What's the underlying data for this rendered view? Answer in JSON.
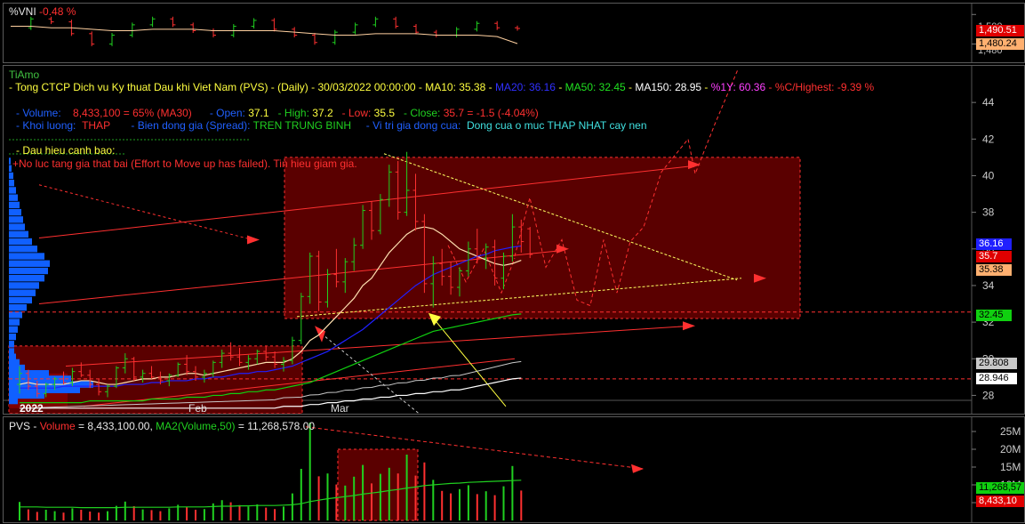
{
  "vni": {
    "title": "%VNI",
    "change": "-0.48 %",
    "tick_top": "1,500",
    "tick_bottom": "1,480",
    "tag_price": "1,490.51",
    "tag_ma": "1,480.24"
  },
  "main": {
    "brand": "TiAmo",
    "header": {
      "prefix": "- Tong CTCP Dich vu Ky thuat Dau khi Viet Nam (PVS) - (Daily) - 30/03/2022 00:00:00 - ",
      "ma10": "MA10: 35.38",
      "ma20": "MA20: 36.16",
      "ma50": "MA50: 32.45",
      "ma150": "MA150: 28.95",
      "one_year": "%1Y: 60.36",
      "c_high": "%C/Highest: -9.39 %"
    },
    "row2": {
      "volume_label": "- Volume:",
      "volume_value": "8,433,100  =  65%  (MA30)",
      "open_label": "- Open:",
      "open_value": "37.1",
      "high_label": "- High:",
      "high_value": "37.2",
      "low_label": "- Low:",
      "low_value": "35.5",
      "close_label": "- Close:",
      "close_value": "35.7  =  -1.5  (-4.04%)"
    },
    "row3": {
      "kl_label": "- Khoi luong:",
      "kl_value": "THAP",
      "spread_label": "- Bien dong gia (Spread):",
      "spread_value": "TREN TRUNG BINH",
      "pos_label": "- Vi tri gia dong cua:",
      "pos_value": "Dong cua o muc THAP NHAT cay nen"
    },
    "warning_title": "- Dau hieu canh bao:",
    "warning_text": "+No luc tang gia that bai (Effort to Move up has failed). Tin hieu giam gia.",
    "x_year": "2022",
    "x_feb": "Feb",
    "x_mar": "Mar",
    "price_tags": {
      "ma20": "36.16",
      "close": "35.7",
      "ma10": "35.38",
      "ma50": "32.45",
      "p1": "29.808",
      "ma150": "28.946"
    }
  },
  "vol": {
    "prefix": "PVS - ",
    "volume_label": "Volume",
    "volume_value": " = 8,433,100.00, ",
    "ma_label": "MA2(Volume,50)",
    "ma_value": " = 11,268,578.00",
    "tag_ma": "11,268,57",
    "tag_vol": "8,433,10"
  },
  "chart_data": [
    {
      "type": "line",
      "title": "%VNI",
      "ylim": [
        1470,
        1505
      ],
      "yticks": [
        "1,500",
        "1,480"
      ],
      "series": [
        {
          "name": "%VNI",
          "values": [
            1491,
            1497,
            1495,
            1487,
            1480,
            1486,
            1493,
            1497,
            1493,
            1489,
            1486,
            1492,
            1496,
            1490,
            1486,
            1481,
            1488,
            1493,
            1497,
            1492,
            1488,
            1486,
            1490,
            1494,
            1491,
            1490.51
          ]
        },
        {
          "name": "MA",
          "values": [
            1492,
            1492,
            1491,
            1491,
            1490,
            1489,
            1489,
            1490,
            1490,
            1490,
            1489,
            1489,
            1489,
            1489,
            1488,
            1487,
            1486,
            1486,
            1487,
            1487,
            1487,
            1486,
            1486,
            1486,
            1485,
            1480.24
          ]
        }
      ]
    },
    {
      "type": "line",
      "title": "PVS (Daily)",
      "x": [
        "2022",
        "Feb",
        "Mar"
      ],
      "ylim": [
        27,
        46
      ],
      "yticks": [
        28,
        30,
        32,
        34,
        36,
        38,
        40,
        42,
        44
      ],
      "candles": [
        {
          "o": 28.6,
          "h": 29.6,
          "l": 28.1,
          "c": 29.2
        },
        {
          "o": 29.2,
          "h": 29.4,
          "l": 28.3,
          "c": 28.5
        },
        {
          "o": 28.5,
          "h": 28.8,
          "l": 27.9,
          "c": 28.1
        },
        {
          "o": 28.1,
          "h": 28.7,
          "l": 27.9,
          "c": 28.6
        },
        {
          "o": 28.6,
          "h": 29.0,
          "l": 28.3,
          "c": 28.9
        },
        {
          "o": 28.9,
          "h": 29.3,
          "l": 28.6,
          "c": 28.7
        },
        {
          "o": 28.7,
          "h": 29.5,
          "l": 28.5,
          "c": 29.3
        },
        {
          "o": 29.3,
          "h": 29.8,
          "l": 29.0,
          "c": 29.1
        },
        {
          "o": 29.1,
          "h": 29.4,
          "l": 28.4,
          "c": 28.6
        },
        {
          "o": 28.6,
          "h": 28.9,
          "l": 28.0,
          "c": 28.2
        },
        {
          "o": 28.2,
          "h": 28.6,
          "l": 27.9,
          "c": 28.5
        },
        {
          "o": 28.5,
          "h": 29.6,
          "l": 28.4,
          "c": 29.5
        },
        {
          "o": 29.5,
          "h": 30.3,
          "l": 29.2,
          "c": 30.0
        },
        {
          "o": 30.0,
          "h": 30.1,
          "l": 28.8,
          "c": 29.0
        },
        {
          "o": 29.0,
          "h": 29.4,
          "l": 28.7,
          "c": 29.2
        },
        {
          "o": 29.2,
          "h": 29.6,
          "l": 28.9,
          "c": 29.0
        },
        {
          "o": 29.0,
          "h": 29.3,
          "l": 28.6,
          "c": 28.8
        },
        {
          "o": 28.8,
          "h": 29.2,
          "l": 28.5,
          "c": 29.1
        },
        {
          "o": 29.1,
          "h": 29.8,
          "l": 29.0,
          "c": 29.7
        },
        {
          "o": 29.7,
          "h": 30.2,
          "l": 29.1,
          "c": 29.3
        },
        {
          "o": 29.3,
          "h": 29.6,
          "l": 28.8,
          "c": 29.0
        },
        {
          "o": 29.0,
          "h": 29.4,
          "l": 28.7,
          "c": 29.2
        },
        {
          "o": 29.2,
          "h": 29.9,
          "l": 29.0,
          "c": 29.8
        },
        {
          "o": 29.8,
          "h": 30.5,
          "l": 29.5,
          "c": 30.3
        },
        {
          "o": 30.3,
          "h": 30.9,
          "l": 29.9,
          "c": 30.1
        },
        {
          "o": 30.1,
          "h": 30.6,
          "l": 29.6,
          "c": 29.8
        },
        {
          "o": 29.8,
          "h": 30.2,
          "l": 29.4,
          "c": 30.0
        },
        {
          "o": 30.0,
          "h": 30.5,
          "l": 29.7,
          "c": 30.4
        },
        {
          "o": 30.4,
          "h": 30.7,
          "l": 29.9,
          "c": 30.1
        },
        {
          "o": 30.1,
          "h": 30.4,
          "l": 29.5,
          "c": 29.7
        },
        {
          "o": 29.7,
          "h": 30.1,
          "l": 29.3,
          "c": 29.9
        },
        {
          "o": 29.9,
          "h": 31.2,
          "l": 29.7,
          "c": 31.0
        },
        {
          "o": 31.0,
          "h": 33.6,
          "l": 30.8,
          "c": 33.4
        },
        {
          "o": 33.4,
          "h": 35.8,
          "l": 33.0,
          "c": 35.6
        },
        {
          "o": 35.6,
          "h": 35.9,
          "l": 32.6,
          "c": 33.1
        },
        {
          "o": 33.1,
          "h": 34.9,
          "l": 32.8,
          "c": 34.6
        },
        {
          "o": 34.6,
          "h": 36.0,
          "l": 33.9,
          "c": 34.2
        },
        {
          "o": 34.2,
          "h": 35.5,
          "l": 33.6,
          "c": 35.3
        },
        {
          "o": 35.3,
          "h": 36.6,
          "l": 34.8,
          "c": 36.2
        },
        {
          "o": 36.2,
          "h": 38.4,
          "l": 36.0,
          "c": 38.1
        },
        {
          "o": 38.1,
          "h": 38.6,
          "l": 36.5,
          "c": 37.0
        },
        {
          "o": 37.0,
          "h": 39.0,
          "l": 36.8,
          "c": 38.7
        },
        {
          "o": 38.7,
          "h": 40.6,
          "l": 38.3,
          "c": 40.2
        },
        {
          "o": 40.2,
          "h": 40.8,
          "l": 37.6,
          "c": 38.0
        },
        {
          "o": 38.0,
          "h": 41.3,
          "l": 37.8,
          "c": 39.2
        },
        {
          "o": 39.2,
          "h": 40.1,
          "l": 37.0,
          "c": 37.5
        },
        {
          "o": 37.5,
          "h": 37.9,
          "l": 33.6,
          "c": 34.1
        },
        {
          "o": 34.1,
          "h": 35.6,
          "l": 32.8,
          "c": 35.2
        },
        {
          "o": 35.2,
          "h": 36.0,
          "l": 34.0,
          "c": 34.5
        },
        {
          "o": 34.5,
          "h": 35.3,
          "l": 33.5,
          "c": 33.9
        },
        {
          "o": 33.9,
          "h": 35.0,
          "l": 33.4,
          "c": 34.8
        },
        {
          "o": 34.8,
          "h": 36.4,
          "l": 34.5,
          "c": 36.0
        },
        {
          "o": 36.0,
          "h": 37.1,
          "l": 35.2,
          "c": 35.5
        },
        {
          "o": 35.5,
          "h": 36.3,
          "l": 34.9,
          "c": 36.1
        },
        {
          "o": 36.1,
          "h": 36.5,
          "l": 34.0,
          "c": 34.4
        },
        {
          "o": 34.4,
          "h": 35.8,
          "l": 33.8,
          "c": 35.6
        },
        {
          "o": 35.6,
          "h": 37.9,
          "l": 35.3,
          "c": 37.2
        },
        {
          "o": 37.2,
          "h": 37.6,
          "l": 35.8,
          "c": 36.4
        },
        {
          "o": 37.1,
          "h": 37.2,
          "l": 35.5,
          "c": 35.7
        }
      ],
      "series": [
        {
          "name": "MA10",
          "values": [
            28.6,
            28.7,
            28.6,
            28.6,
            28.6,
            28.6,
            28.7,
            28.8,
            28.8,
            28.7,
            28.6,
            28.6,
            28.7,
            28.8,
            28.9,
            28.9,
            29.0,
            29.0,
            29.1,
            29.2,
            29.2,
            29.1,
            29.2,
            29.3,
            29.4,
            29.5,
            29.6,
            29.7,
            29.8,
            29.8,
            29.8,
            30.0,
            30.4,
            31.0,
            31.3,
            31.8,
            32.3,
            32.8,
            33.3,
            34.0,
            34.4,
            35.1,
            35.8,
            36.3,
            36.8,
            37.1,
            37.2,
            37.1,
            36.8,
            36.4,
            36.0,
            35.8,
            35.6,
            35.4,
            35.2,
            35.1,
            35.2,
            35.38
          ]
        },
        {
          "name": "MA20",
          "values": [
            28.4,
            28.4,
            28.4,
            28.4,
            28.4,
            28.5,
            28.5,
            28.5,
            28.5,
            28.5,
            28.5,
            28.5,
            28.6,
            28.6,
            28.6,
            28.7,
            28.7,
            28.8,
            28.8,
            28.8,
            28.9,
            28.9,
            29.0,
            29.0,
            29.1,
            29.2,
            29.2,
            29.3,
            29.3,
            29.4,
            29.5,
            29.6,
            29.8,
            30.0,
            30.2,
            30.4,
            30.7,
            31.0,
            31.3,
            31.6,
            32.0,
            32.4,
            32.8,
            33.2,
            33.6,
            34.0,
            34.3,
            34.6,
            34.8,
            35.0,
            35.2,
            35.4,
            35.6,
            35.7,
            35.9,
            36.0,
            36.1,
            36.16
          ]
        },
        {
          "name": "MA50",
          "values": [
            27.6,
            27.6,
            27.6,
            27.6,
            27.6,
            27.6,
            27.6,
            27.6,
            27.7,
            27.7,
            27.7,
            27.7,
            27.7,
            27.7,
            27.7,
            27.8,
            27.8,
            27.8,
            27.8,
            27.9,
            27.9,
            27.9,
            28.0,
            28.0,
            28.1,
            28.1,
            28.2,
            28.2,
            28.3,
            28.3,
            28.4,
            28.5,
            28.6,
            28.7,
            28.9,
            29.1,
            29.3,
            29.5,
            29.7,
            29.9,
            30.1,
            30.3,
            30.5,
            30.7,
            30.9,
            31.1,
            31.3,
            31.5,
            31.6,
            31.7,
            31.8,
            31.9,
            32.0,
            32.1,
            32.2,
            32.3,
            32.4,
            32.45
          ]
        },
        {
          "name": "MA150",
          "values": [
            27.3,
            27.3,
            27.3,
            27.3,
            27.3,
            27.3,
            27.3,
            27.3,
            27.3,
            27.3,
            27.3,
            27.3,
            27.3,
            27.3,
            27.3,
            27.3,
            27.3,
            27.3,
            27.3,
            27.3,
            27.3,
            27.3,
            27.3,
            27.3,
            27.3,
            27.3,
            27.3,
            27.3,
            27.3,
            27.3,
            27.4,
            27.4,
            27.4,
            27.5,
            27.5,
            27.6,
            27.6,
            27.7,
            27.7,
            27.8,
            27.8,
            27.9,
            27.9,
            28.0,
            28.0,
            28.1,
            28.1,
            28.2,
            28.2,
            28.3,
            28.3,
            28.4,
            28.5,
            28.6,
            28.7,
            28.8,
            28.9,
            28.946
          ]
        }
      ]
    },
    {
      "type": "bar",
      "title": "PVS - Volume",
      "ylim": [
        0,
        28
      ],
      "yticks": [
        "5M",
        "10M",
        "15M",
        "20M",
        "25M"
      ],
      "series": [
        {
          "name": "Volume",
          "values": [
            5.2,
            3.1,
            2.4,
            3.0,
            2.6,
            2.2,
            3.4,
            3.0,
            2.5,
            2.2,
            2.6,
            4.1,
            5.3,
            4.0,
            3.1,
            2.9,
            2.6,
            3.4,
            4.4,
            3.7,
            3.0,
            3.2,
            4.8,
            5.7,
            5.1,
            4.3,
            3.9,
            4.5,
            3.6,
            3.2,
            3.9,
            7.6,
            14.5,
            27.5,
            12.4,
            13.2,
            10.1,
            9.8,
            12.3,
            15.6,
            10.4,
            13.1,
            14.8,
            13.2,
            18.5,
            12.6,
            16.3,
            11.4,
            8.3,
            7.6,
            8.8,
            9.9,
            7.4,
            8.2,
            7.1,
            9.6,
            15.3,
            8.4
          ]
        },
        {
          "name": "MA2(Volume,50)",
          "values": [
            3.8,
            3.8,
            3.8,
            3.7,
            3.7,
            3.7,
            3.7,
            3.6,
            3.6,
            3.6,
            3.6,
            3.6,
            3.7,
            3.7,
            3.7,
            3.7,
            3.7,
            3.7,
            3.8,
            3.8,
            3.8,
            3.8,
            3.9,
            4.0,
            4.0,
            4.1,
            4.1,
            4.2,
            4.2,
            4.2,
            4.3,
            4.4,
            4.7,
            5.3,
            5.7,
            6.1,
            6.4,
            6.7,
            7.0,
            7.4,
            7.7,
            8.0,
            8.4,
            8.7,
            9.1,
            9.4,
            9.8,
            10.0,
            10.2,
            10.4,
            10.5,
            10.7,
            10.8,
            10.9,
            11.0,
            11.1,
            11.2,
            11.3
          ]
        }
      ]
    }
  ]
}
